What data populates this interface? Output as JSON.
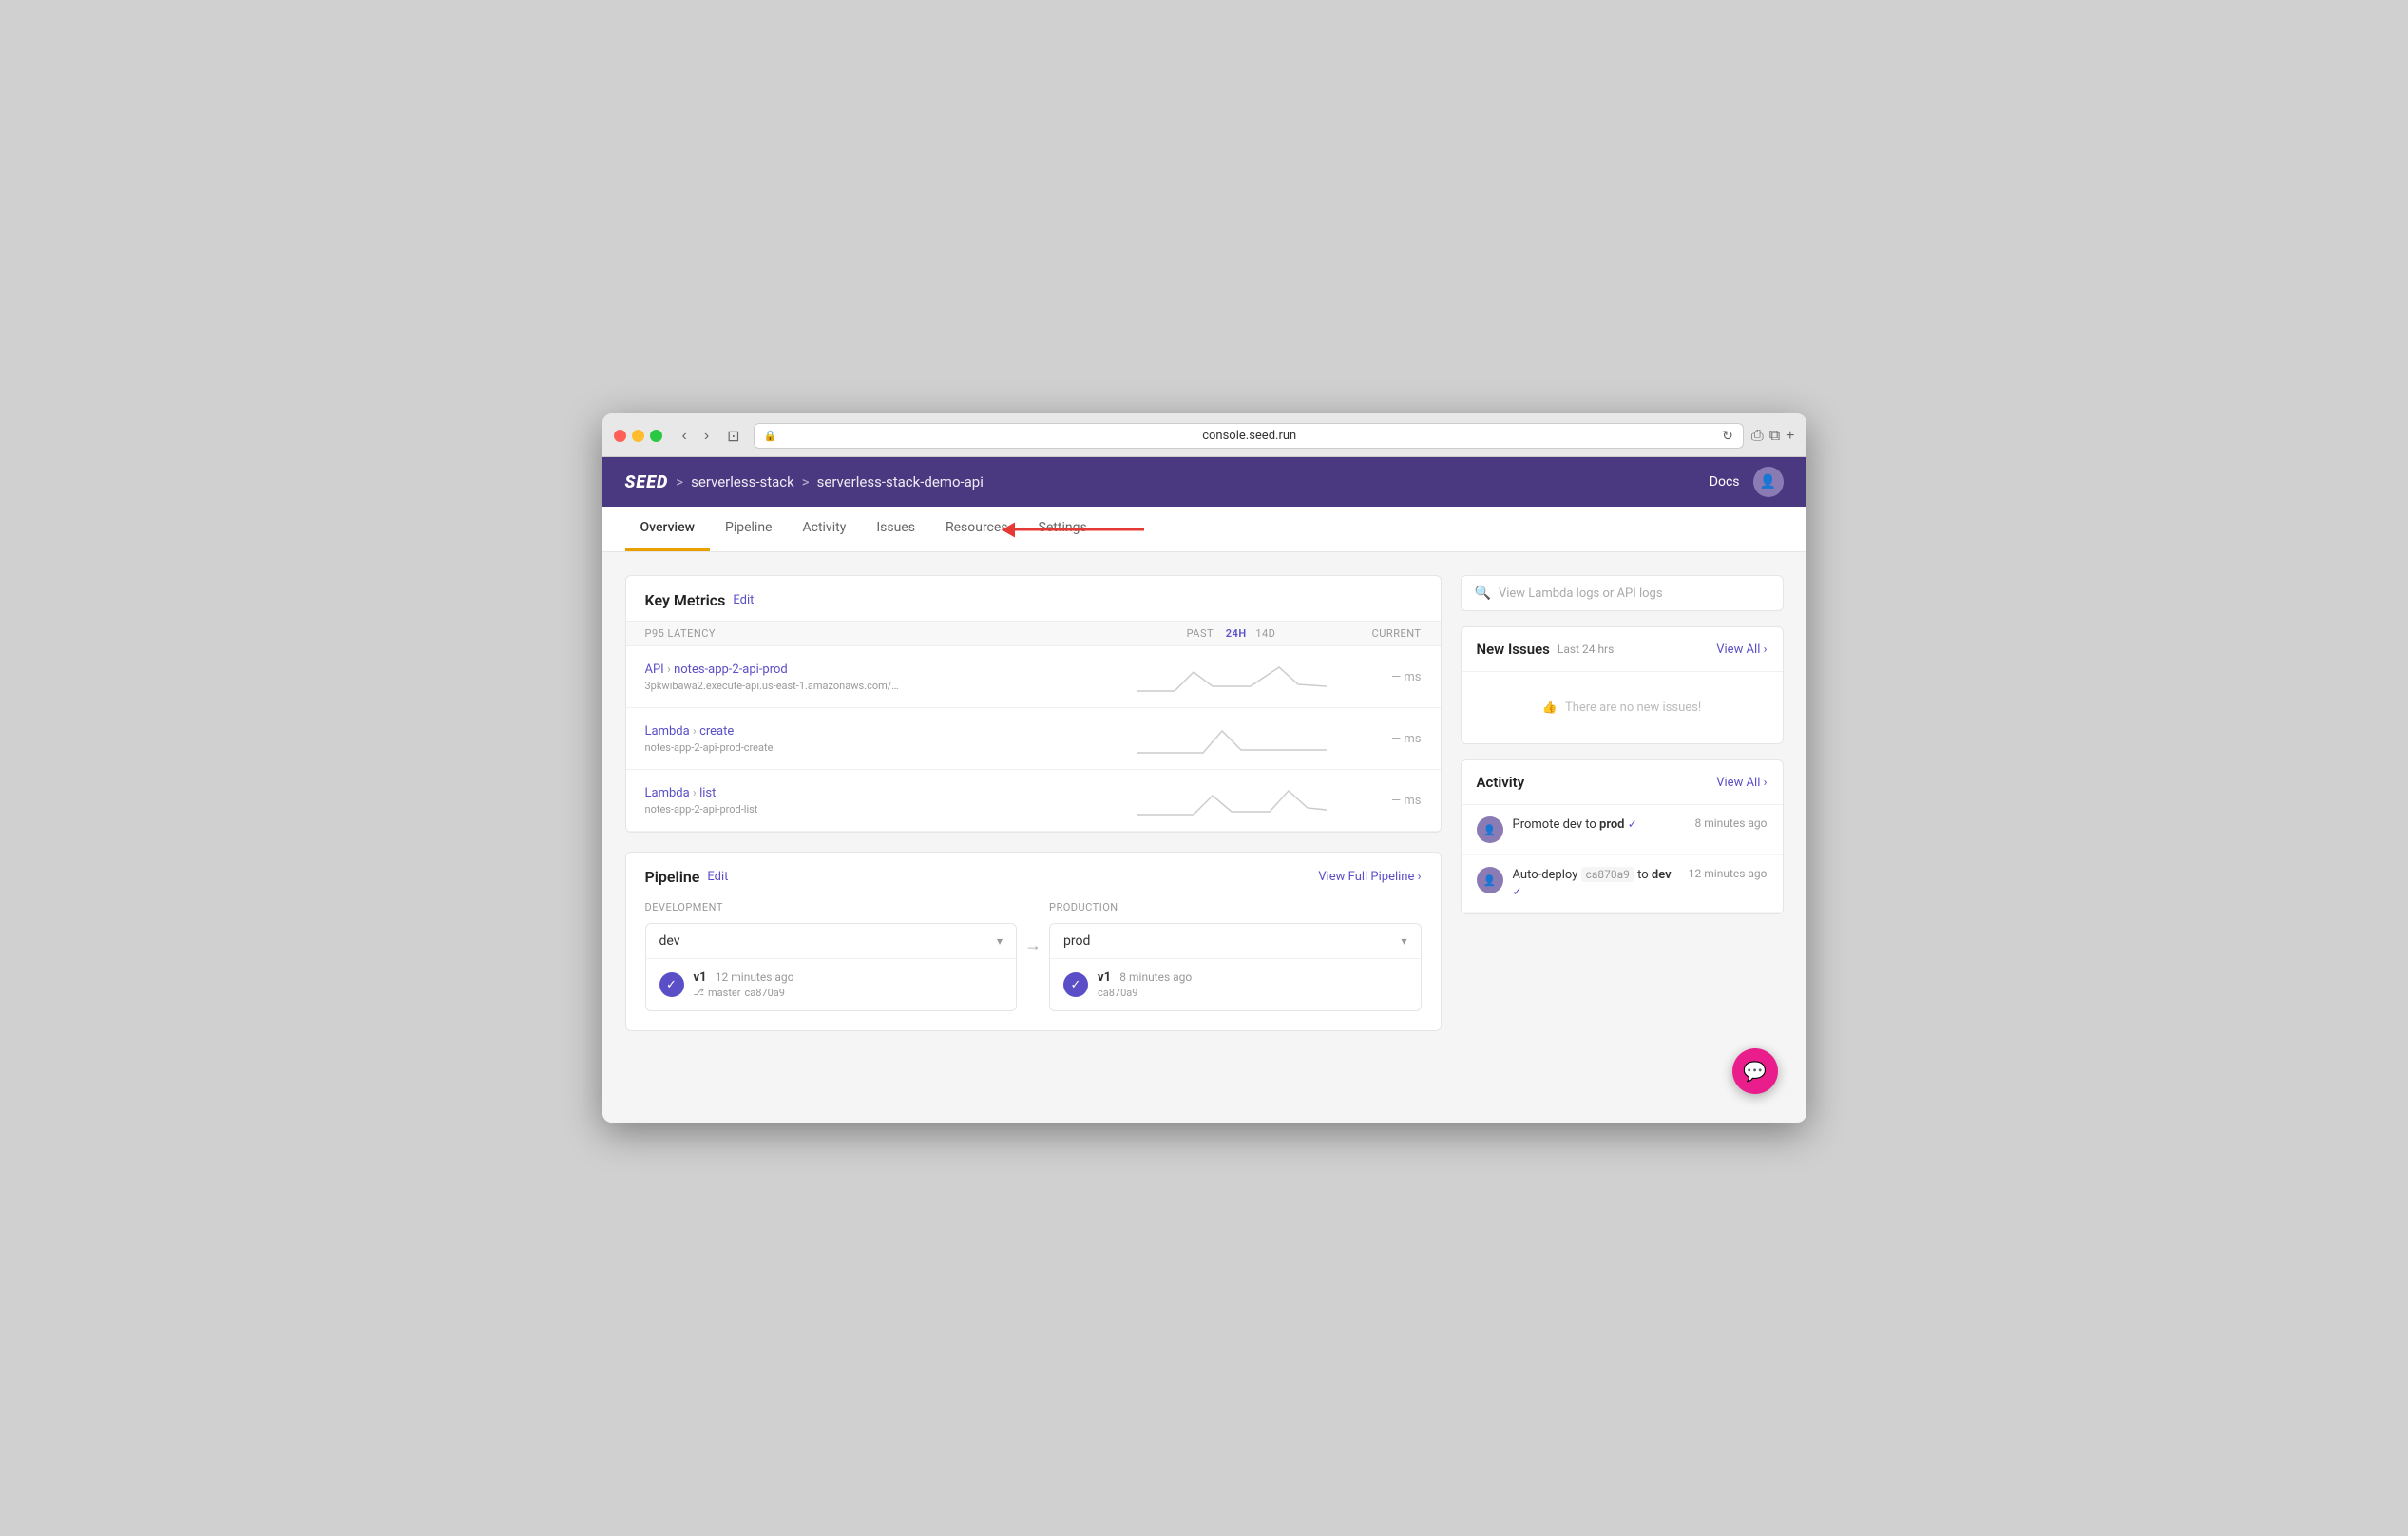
{
  "browser": {
    "url": "console.seed.run",
    "back_label": "‹",
    "forward_label": "›",
    "sidebar_label": "⊡",
    "reload_label": "↻",
    "share_label": "⎙",
    "tab_label": "⧉",
    "new_tab_label": "+"
  },
  "header": {
    "logo": "SEED",
    "breadcrumb_sep": ">",
    "project": "serverless-stack",
    "stack": "serverless-stack-demo-api",
    "docs_label": "Docs"
  },
  "nav": {
    "tabs": [
      {
        "id": "overview",
        "label": "Overview",
        "active": true
      },
      {
        "id": "pipeline",
        "label": "Pipeline",
        "active": false
      },
      {
        "id": "activity",
        "label": "Activity",
        "active": false
      },
      {
        "id": "issues",
        "label": "Issues",
        "active": false
      },
      {
        "id": "resources",
        "label": "Resources",
        "active": false
      },
      {
        "id": "settings",
        "label": "Settings",
        "active": false
      }
    ]
  },
  "key_metrics": {
    "title": "Key Metrics",
    "edit_label": "Edit",
    "col_name": "P95 Latency",
    "col_past": "PAST",
    "col_24h": "24H",
    "col_14d": "14D",
    "col_current": "CURRENT",
    "rows": [
      {
        "type": "API",
        "name": "notes-app-2-api-prod",
        "sub": "3pkwibawa2.execute-api.us-east-1.amazonaws.com/…",
        "value": "— ms"
      },
      {
        "type": "Lambda",
        "name": "create",
        "sub": "notes-app-2-api-prod-create",
        "value": "— ms"
      },
      {
        "type": "Lambda",
        "name": "list",
        "sub": "notes-app-2-api-prod-list",
        "value": "— ms"
      }
    ]
  },
  "pipeline": {
    "title": "Pipeline",
    "edit_label": "Edit",
    "view_full_label": "View Full Pipeline ›",
    "stages": [
      {
        "id": "development",
        "label": "DEVELOPMENT",
        "env_name": "dev",
        "version": "v1",
        "time": "12 minutes ago",
        "branch": "master",
        "commit": "ca870a9"
      },
      {
        "id": "production",
        "label": "PRODUCTION",
        "env_name": "prod",
        "version": "v1",
        "time": "8 minutes ago",
        "branch": null,
        "commit": "ca870a9"
      }
    ]
  },
  "right_panel": {
    "search_placeholder": "View Lambda logs or API logs",
    "new_issues": {
      "title": "New Issues",
      "subtitle": "Last 24 hrs",
      "view_all": "View All ›",
      "empty_message": "There are no new issues!"
    },
    "activity": {
      "title": "Activity",
      "view_all": "View All ›",
      "items": [
        {
          "id": 1,
          "text_parts": [
            "Promote dev to ",
            "prod",
            " ✓"
          ],
          "time": "8 minutes ago",
          "action": "Promote dev to",
          "target": "prod",
          "has_check": true
        },
        {
          "id": 2,
          "text_parts": [
            "Auto-deploy ",
            "ca870a9",
            " to ",
            "dev",
            " ✓"
          ],
          "time": "12 minutes ago",
          "action": "Auto-deploy",
          "commit": "ca870a9",
          "target": "dev",
          "has_check": true
        }
      ]
    }
  },
  "colors": {
    "accent": "#5b4fc8",
    "header_bg": "#4a3880",
    "active_tab": "#e8a000",
    "error": "#e53935",
    "chat_fab": "#e91e8c"
  }
}
